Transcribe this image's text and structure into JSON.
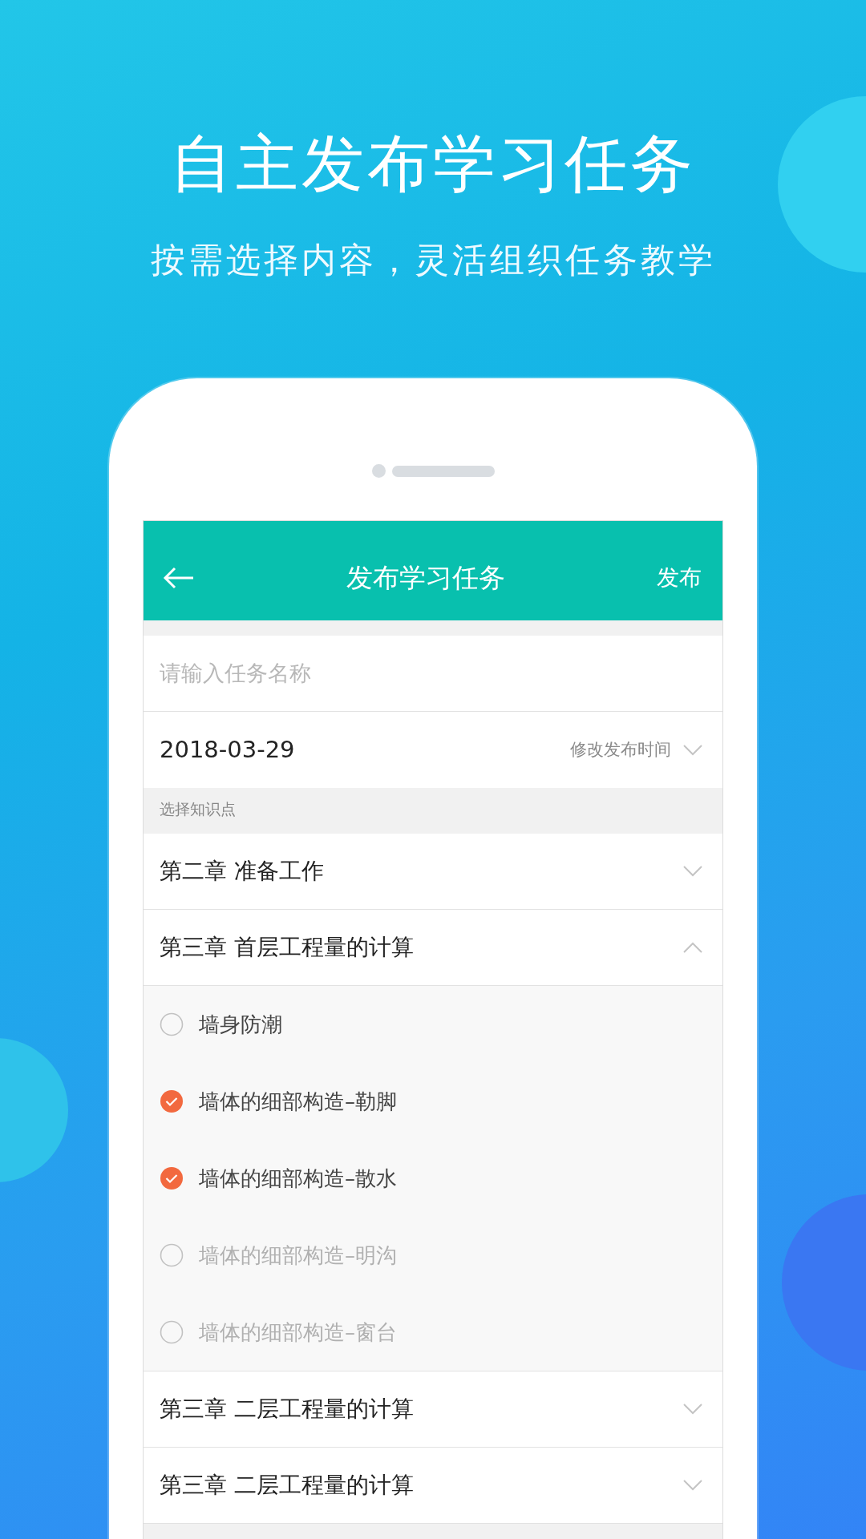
{
  "headline": "自主发布学习任务",
  "subheadline": "按需选择内容，灵活组织任务教学",
  "app_bar": {
    "title": "发布学习任务",
    "action": "发布"
  },
  "task_name": {
    "placeholder": "请输入任务名称"
  },
  "publish_date": {
    "value": "2018-03-29",
    "action": "修改发布时间"
  },
  "section_label": "选择知识点",
  "chapters": [
    {
      "title": "第二章 准备工作",
      "expanded": false
    },
    {
      "title": "第三章 首层工程量的计算",
      "expanded": true,
      "children": [
        {
          "label": "墙身防潮",
          "checked": false,
          "disabled": false
        },
        {
          "label": "墙体的细部构造–勒脚",
          "checked": true,
          "disabled": false
        },
        {
          "label": "墙体的细部构造–散水",
          "checked": true,
          "disabled": false
        },
        {
          "label": "墙体的细部构造–明沟",
          "checked": false,
          "disabled": true
        },
        {
          "label": "墙体的细部构造–窗台",
          "checked": false,
          "disabled": true
        }
      ]
    },
    {
      "title": "第三章 二层工程量的计算",
      "expanded": false
    },
    {
      "title": "第三章 二层工程量的计算",
      "expanded": false
    }
  ]
}
